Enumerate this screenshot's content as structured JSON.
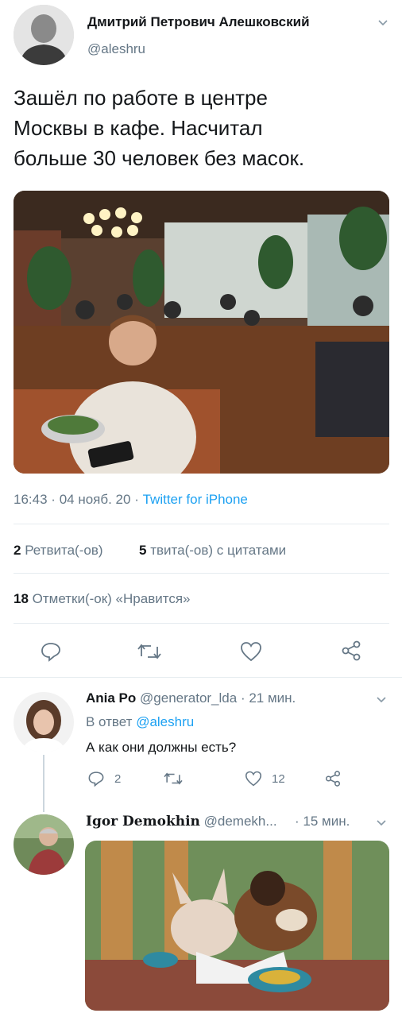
{
  "tweet": {
    "author_name": "Дмитрий Петрович Алешковский",
    "author_handle": "@aleshru",
    "text_lines": [
      "Зашёл по работе в центре",
      "Москвы в кафе. Насчитал",
      "больше 30 человек без масок."
    ],
    "time": "16:43",
    "date": "04 нояб. 20",
    "source": "Twitter for iPhone",
    "retweets_count": "2",
    "retweets_label": "Ретвита(-ов)",
    "quotes_count": "5",
    "quotes_label": "твита(-ов) с цитатами",
    "likes_count": "18",
    "likes_label": "Отметки(-ок) «Нравится»"
  },
  "reply1": {
    "name": "Ania Po",
    "handle": "@generator_lda",
    "time": "21 мин.",
    "reply_to_prefix": "В ответ",
    "reply_to_handle": "@aleshru",
    "text": "А как они должны есть?",
    "reply_count": "2",
    "like_count": "12"
  },
  "reply2": {
    "name": "Igor Demokhin",
    "handle": "@demekh...",
    "time": "15 мин."
  },
  "icons": [
    "chevron-down-icon",
    "reply-icon",
    "retweet-icon",
    "like-icon",
    "share-icon"
  ],
  "colors": {
    "link": "#1da1f2",
    "muted": "#657786",
    "divider": "#e6ecf0"
  },
  "separator": "·"
}
